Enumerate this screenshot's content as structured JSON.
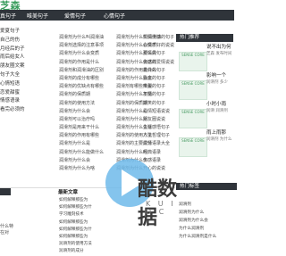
{
  "header": {
    "logo": "芝森"
  },
  "nav": [
    "真句子",
    "唯美句子",
    "爱情句子",
    "心情句子"
  ],
  "left_list": [
    "爱夏句子",
    "自己的伤",
    "月经后的子",
    "雨后给女人",
    "朋友圈文案",
    "句子大全",
    "心情短语",
    "恋爱甜蜜",
    "情感语录",
    "看完必须的"
  ],
  "col1": [
    "润滑剂为什么叫润滑油",
    "润滑剂选择的注意事项",
    "润滑剂为什么会变质",
    "润滑剂的作用是什么",
    "润滑剂和润滑油的区别",
    "润滑剂的成分有哪些",
    "润滑剂的优缺点有哪些",
    "润滑剂的保质期",
    "润滑剂的使用方法",
    "润滑剂为什么会",
    "润滑剂可以治疗吗",
    "润滑剂是用来干什么",
    "润滑剂的作用有哪些",
    "润滑剂为什么是",
    "润滑剂为什么能做什么",
    "润滑剂为什么会",
    "润滑剂为什么为啥"
  ],
  "col2": [
    "润滑剂为什么叫润滑油",
    "润滑剂为什么会变质",
    "润滑剂为什么那么贵",
    "润滑剂为什么会这样",
    "润滑剂的作用是什么",
    "润滑剂为什么会变",
    "润滑剂有哪些类型",
    "润滑剂为什么不能",
    "润滑剂的保质期",
    "润滑剂为什么是",
    "润滑剂为什么对",
    "润滑剂为什么会有",
    "润滑剂的使用方法",
    "润滑剂的主要成分",
    "润滑剂为什么叫",
    "润滑剂为什么多",
    "润滑剂为什么"
  ],
  "col3": [
    "爱情伤感的句子",
    "心情不好的说说",
    "爱情的句子",
    "伤感的爱情说说",
    "表白的句子",
    "励志的句子",
    "唯美的句子",
    "友情的句子",
    "搞笑的句子",
    "心情短语说说",
    "朋友圈说说",
    "生活感悟句子",
    "人生哲理句子",
    "爱情语录大全",
    "经典语录",
    "伤感语录",
    "开心的说说"
  ],
  "sidebar_head": "热门推荐",
  "cards": [
    {
      "title": "说不出为何",
      "text": "芝森 发布时间",
      "img": "SENSE CORE"
    },
    {
      "title": "影响一个",
      "text": "润滑剂 多少",
      "img": "SENSE CORE"
    },
    {
      "title": "小时小雨",
      "text": "润滑 润滑剂",
      "img": "SENSE CORE"
    },
    {
      "title": "雨上雨那",
      "text": "润滑剂 为什么",
      "img": "SENSE CORE"
    }
  ],
  "section": {
    "title": "最新文章",
    "items": [
      "如何解释那些为",
      "如何解释那些为什",
      "学习雕刻技术",
      "如何解释那些为",
      "如何解释那些为什",
      "如何解释那些为",
      "润滑剂的使用方法",
      "润滑剂的成分"
    ]
  },
  "bottom_left": [
    "什么特",
    "在对"
  ],
  "tags_head": "热门标签",
  "tags": [
    "润滑剂",
    "润滑剂为什么",
    "润滑剂为什么会",
    "为什么润滑剂",
    "为什么润滑剂是什么"
  ],
  "watermark": {
    "text": "酷数据",
    "sub": "K U I D C"
  }
}
